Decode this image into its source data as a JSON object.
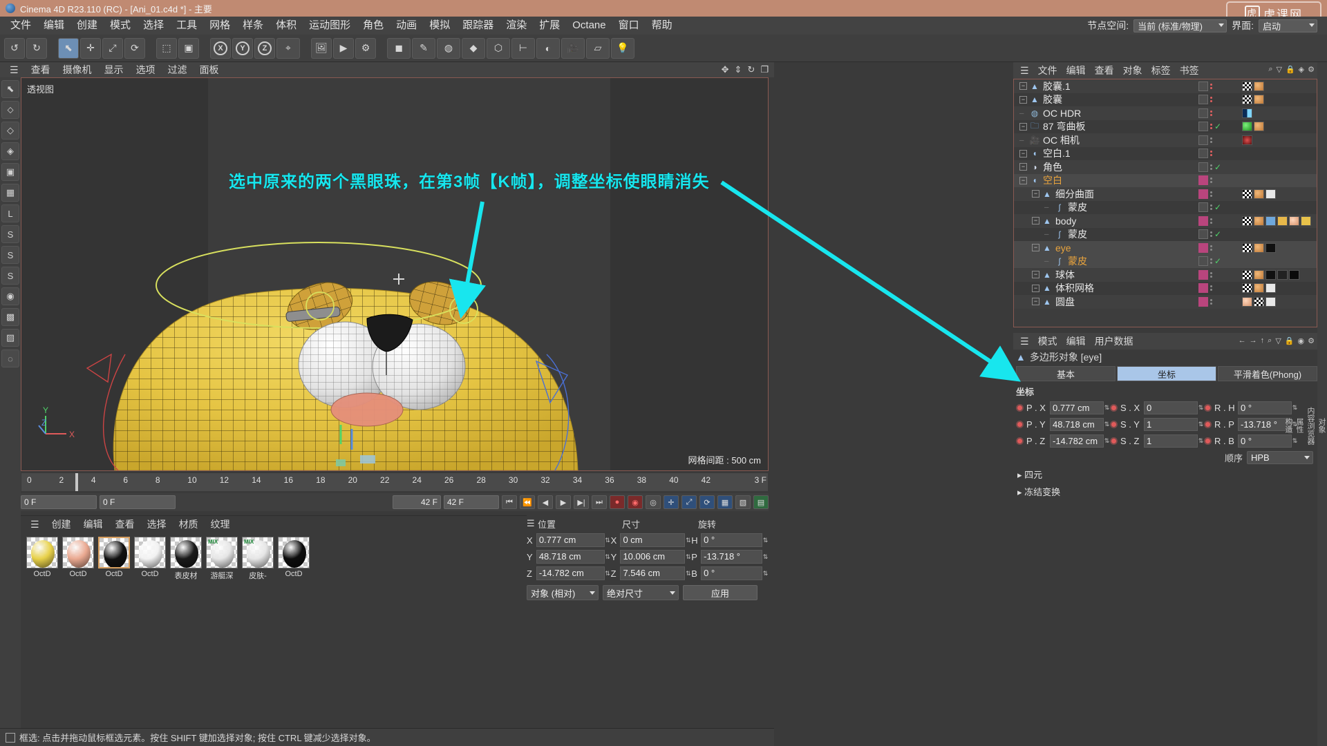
{
  "window": {
    "title": "Cinema 4D R23.110 (RC) - [Ani_01.c4d *] - 主要",
    "watermark": "虎课网"
  },
  "menubar": {
    "items": [
      "文件",
      "编辑",
      "创建",
      "模式",
      "选择",
      "工具",
      "网格",
      "样条",
      "体积",
      "运动图形",
      "角色",
      "动画",
      "模拟",
      "跟踪器",
      "渲染",
      "扩展",
      "Octane",
      "窗口",
      "帮助"
    ],
    "node_space_label": "节点空间:",
    "node_space_value": "当前 (标准/物理)",
    "interface_label": "界面:",
    "interface_value": "启动"
  },
  "toolbar": {
    "undo": "undo-arrow",
    "redo": "redo-arrow",
    "tools": [
      "选择",
      "移动",
      "缩放",
      "旋转"
    ],
    "axis_locks": [
      "X",
      "Y",
      "Z"
    ],
    "world_label": "W"
  },
  "viewport": {
    "menu": [
      "查看",
      "摄像机",
      "显示",
      "选项",
      "过滤",
      "面板"
    ],
    "label": "透视图",
    "grid_note": "网格间距 : 500 cm",
    "annotation": "选中原来的两个黑眼珠，在第3帧【K帧】，调整坐标使眼睛消失",
    "axis_x": "X",
    "axis_y": "Y",
    "axis_z": "Z",
    "accent_cyan": "#18e6ee",
    "border_color": "#8a5a52"
  },
  "timeline": {
    "ticks": [
      "0",
      "2",
      "4",
      "6",
      "8",
      "10",
      "12",
      "14",
      "16",
      "18",
      "20",
      "22",
      "24",
      "26",
      "28",
      "30",
      "32",
      "34",
      "36",
      "38",
      "40",
      "42"
    ],
    "playhead_frame": "3",
    "end_label": "3 F",
    "current_frame_field": "0 F",
    "preview_start_field": "0 F",
    "preview_end_field": "42 F",
    "end_frame_field": "42 F"
  },
  "materials": {
    "menu": [
      "创建",
      "编辑",
      "查看",
      "选择",
      "材质",
      "纹理"
    ],
    "items": [
      {
        "name": "OctD",
        "color": "#e8d14a",
        "tag": "",
        "selected": false
      },
      {
        "name": "OctD",
        "color": "#eaa991",
        "tag": "",
        "selected": false
      },
      {
        "name": "OctD",
        "color": "#111111",
        "tag": "",
        "selected": true
      },
      {
        "name": "OctD",
        "color": "#f2f2f2",
        "tag": "",
        "selected": false
      },
      {
        "name": "表皮材",
        "color": "#1a1a1a",
        "tag": "",
        "selected": false
      },
      {
        "name": "游艇深",
        "color": "#e6e6e6",
        "tag": "MIX",
        "selected": false
      },
      {
        "name": "皮肤-",
        "color": "#e6e6e6",
        "tag": "MIX",
        "selected": false
      },
      {
        "name": "OctD",
        "color": "#0d0d0d",
        "tag": "",
        "selected": false
      }
    ]
  },
  "coord_manager": {
    "headers": [
      "位置",
      "尺寸",
      "旋转"
    ],
    "rows": [
      {
        "axis": "X",
        "position": "0.777 cm",
        "size": "0 cm",
        "rot_label": "H",
        "rotation": "0 °"
      },
      {
        "axis": "Y",
        "position": "48.718 cm",
        "size": "10.006 cm",
        "rot_label": "P",
        "rotation": "-13.718 °"
      },
      {
        "axis": "Z",
        "position": "-14.782 cm",
        "size": "7.546 cm",
        "rot_label": "B",
        "rotation": "0 °"
      }
    ],
    "mode_select": "对象 (相对)",
    "size_select": "绝对尺寸",
    "apply_button": "应用"
  },
  "statusbar": {
    "text": "框选: 点击并拖动鼠标框选元素。按住 SHIFT 键加选择对象; 按住 CTRL 键减少选择对象。"
  },
  "object_manager": {
    "menu": [
      "文件",
      "编辑",
      "查看",
      "对象",
      "标签",
      "书签"
    ],
    "objects": [
      {
        "name": "胶囊.1",
        "indent": 0,
        "icon": "polygon",
        "expandable": true,
        "selected": false,
        "tagbox": true,
        "dots": "red",
        "check": false,
        "tags": [
          "checker",
          "spheres"
        ]
      },
      {
        "name": "胶囊",
        "indent": 0,
        "icon": "polygon",
        "expandable": true,
        "selected": false,
        "tagbox": true,
        "dots": "red",
        "check": false,
        "tags": [
          "checker",
          "spheres"
        ]
      },
      {
        "name": "OC HDR",
        "indent": 0,
        "icon": "sky",
        "expandable": false,
        "selected": false,
        "tagbox": true,
        "dots": "red",
        "check": false,
        "tags": [
          "half"
        ]
      },
      {
        "name": "87 弯曲板",
        "indent": 0,
        "icon": "folder",
        "expandable": true,
        "selected": false,
        "tagbox": true,
        "dots": "red",
        "check": true,
        "tags": [
          "green",
          "spheres"
        ]
      },
      {
        "name": "OC 相机",
        "indent": 0,
        "icon": "camera",
        "expandable": false,
        "selected": false,
        "tagbox": true,
        "dots": "dim",
        "check": false,
        "tags": [
          "cam"
        ]
      },
      {
        "name": "空白.1",
        "indent": 0,
        "icon": "null",
        "expandable": true,
        "selected": false,
        "tagbox": true,
        "dots": "red",
        "check": false,
        "tags": []
      },
      {
        "name": "角色",
        "indent": 0,
        "icon": "char",
        "expandable": true,
        "selected": false,
        "tagbox": true,
        "dots": "dim",
        "check": true,
        "tags": []
      },
      {
        "name": "空白",
        "indent": 0,
        "icon": "null",
        "expandable": true,
        "selected": true,
        "tagbox": false,
        "dots": "dim",
        "check": false,
        "tags": []
      },
      {
        "name": "细分曲面",
        "indent": 1,
        "icon": "polygon",
        "expandable": true,
        "selected": false,
        "tagbox": false,
        "dots": "dim",
        "check": false,
        "tags": [
          "checker",
          "spheres",
          "white"
        ]
      },
      {
        "name": "蒙皮",
        "indent": 2,
        "icon": "skin",
        "expandable": false,
        "selected": false,
        "tagbox": true,
        "dots": "dim",
        "check": true,
        "tags": []
      },
      {
        "name": "body",
        "indent": 1,
        "icon": "polygon",
        "expandable": true,
        "selected": false,
        "tagbox": false,
        "dots": "dim",
        "check": false,
        "tags": [
          "checker",
          "spheres",
          "q1",
          "q2",
          "skin2",
          "tri"
        ]
      },
      {
        "name": "蒙皮",
        "indent": 2,
        "icon": "skin",
        "expandable": false,
        "selected": false,
        "tagbox": true,
        "dots": "dim",
        "check": true,
        "tags": []
      },
      {
        "name": "eye",
        "indent": 1,
        "icon": "polygon",
        "expandable": true,
        "selected": true,
        "tagbox": false,
        "dots": "dim",
        "check": false,
        "tags": [
          "checker",
          "spheres",
          "black"
        ]
      },
      {
        "name": "蒙皮",
        "indent": 2,
        "icon": "skin",
        "expandable": false,
        "selected": true,
        "tagbox": true,
        "dots": "dim",
        "check": true,
        "tags": []
      },
      {
        "name": "球体",
        "indent": 1,
        "icon": "polygon",
        "expandable": true,
        "selected": false,
        "tagbox": false,
        "dots": "dim",
        "check": false,
        "tags": [
          "checker",
          "spheres",
          "b1",
          "b2",
          "b3"
        ]
      },
      {
        "name": "体积网格",
        "indent": 1,
        "icon": "polygon",
        "expandable": true,
        "selected": false,
        "tagbox": false,
        "dots": "dim",
        "check": false,
        "tags": [
          "checker",
          "spheres",
          "white"
        ]
      },
      {
        "name": "圆盘",
        "indent": 1,
        "icon": "polygon",
        "expandable": true,
        "selected": false,
        "tagbox": false,
        "dots": "dim",
        "check": false,
        "tags": [
          "skin2",
          "checker",
          "white"
        ]
      }
    ]
  },
  "attributes": {
    "menu": [
      "模式",
      "编辑",
      "用户数据"
    ],
    "title": "多边形对象 [eye]",
    "tabs": [
      "基本",
      "坐标",
      "平滑着色(Phong)"
    ],
    "active_tab": "坐标",
    "section": "坐标",
    "rows": [
      {
        "p_label": "P . X",
        "p_value": "0.777 cm",
        "s_label": "S . X",
        "s_value": "0",
        "r_label": "R . H",
        "r_value": "0 °"
      },
      {
        "p_label": "P . Y",
        "p_value": "48.718 cm",
        "s_label": "S . Y",
        "s_value": "1",
        "r_label": "R . P",
        "r_value": "-13.718 °"
      },
      {
        "p_label": "P . Z",
        "p_value": "-14.782 cm",
        "s_label": "S . Z",
        "s_value": "1",
        "r_label": "R . B",
        "r_value": "0 °"
      }
    ],
    "order_label": "顺序",
    "order_value": "HPB",
    "expanders": [
      "四元",
      "冻结变换"
    ]
  },
  "far_right": {
    "items": [
      "对象",
      "内容浏览器",
      "属性",
      "构造"
    ]
  }
}
